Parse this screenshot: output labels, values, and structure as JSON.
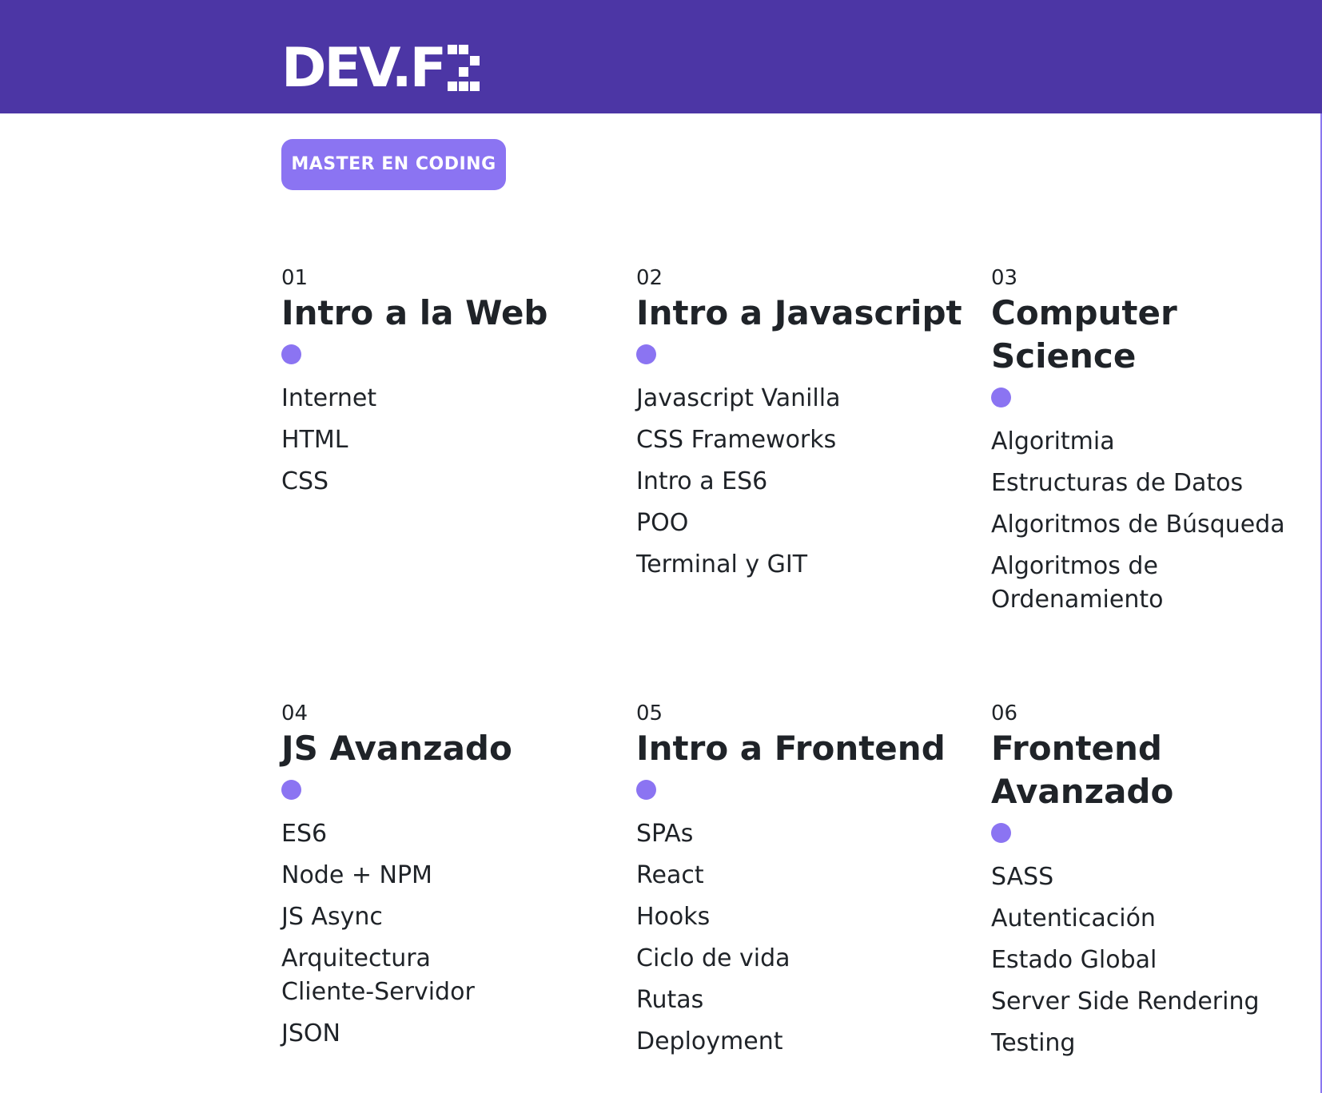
{
  "header": {
    "logo_text": "DEV.F",
    "background": "#4c36a5"
  },
  "badge": {
    "label": "MASTER EN CODING",
    "color": "#8b74f2"
  },
  "modules": [
    {
      "num": "01",
      "title": "Intro a la Web",
      "topics": [
        "Internet",
        "HTML",
        "CSS"
      ]
    },
    {
      "num": "02",
      "title": "Intro a Javascript",
      "topics": [
        "Javascript Vanilla",
        "CSS Frameworks",
        "Intro a ES6",
        "POO",
        "Terminal y GIT"
      ]
    },
    {
      "num": "03",
      "title": "Computer Science",
      "topics": [
        "Algoritmia",
        "Estructuras de Datos",
        "Algoritmos de Búsqueda",
        "Algoritmos de Ordenamiento"
      ]
    },
    {
      "num": "04",
      "title": "JS Avanzado",
      "topics": [
        "ES6",
        "Node + NPM",
        "JS Async",
        "Arquitectura Cliente-Servidor",
        "JSON"
      ]
    },
    {
      "num": "05",
      "title": "Intro a Frontend",
      "topics": [
        "SPAs",
        "React",
        "Hooks",
        "Ciclo de vida",
        "Rutas",
        "Deployment"
      ]
    },
    {
      "num": "06",
      "title": "Frontend Avanzado",
      "topics": [
        "SASS",
        "Autenticación",
        "Estado Global",
        "Server Side Rendering",
        "Testing"
      ]
    }
  ]
}
